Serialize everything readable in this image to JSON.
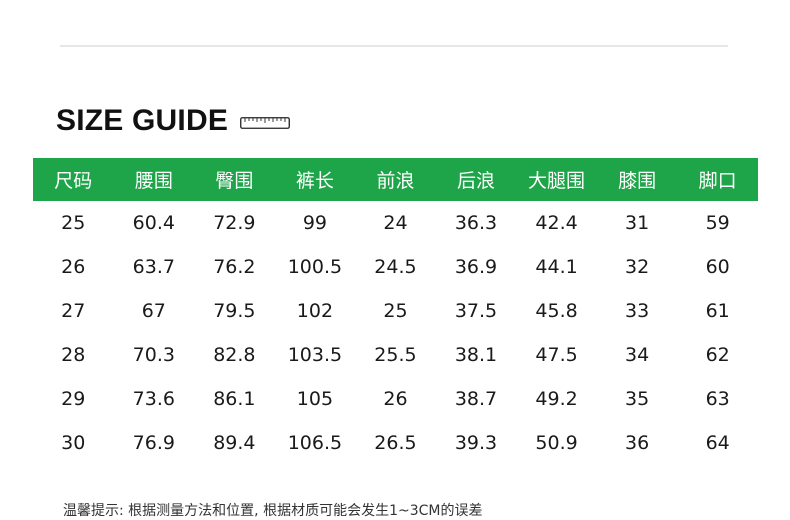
{
  "title": "SIZE GUIDE",
  "accent_color": "#1fa549",
  "icons": [
    "ruler-icon"
  ],
  "table": {
    "headers": [
      "尺码",
      "腰围",
      "臀围",
      "裤长",
      "前浪",
      "后浪",
      "大腿围",
      "膝围",
      "脚口"
    ],
    "rows": [
      [
        "25",
        "60.4",
        "72.9",
        "99",
        "24",
        "36.3",
        "42.4",
        "31",
        "59"
      ],
      [
        "26",
        "63.7",
        "76.2",
        "100.5",
        "24.5",
        "36.9",
        "44.1",
        "32",
        "60"
      ],
      [
        "27",
        "67",
        "79.5",
        "102",
        "25",
        "37.5",
        "45.8",
        "33",
        "61"
      ],
      [
        "28",
        "70.3",
        "82.8",
        "103.5",
        "25.5",
        "38.1",
        "47.5",
        "34",
        "62"
      ],
      [
        "29",
        "73.6",
        "86.1",
        "105",
        "26",
        "38.7",
        "49.2",
        "35",
        "63"
      ],
      [
        "30",
        "76.9",
        "89.4",
        "106.5",
        "26.5",
        "39.3",
        "50.9",
        "36",
        "64"
      ]
    ]
  },
  "note": "温馨提示: 根据测量方法和位置, 根据材质可能会发生1~3CM的误差"
}
